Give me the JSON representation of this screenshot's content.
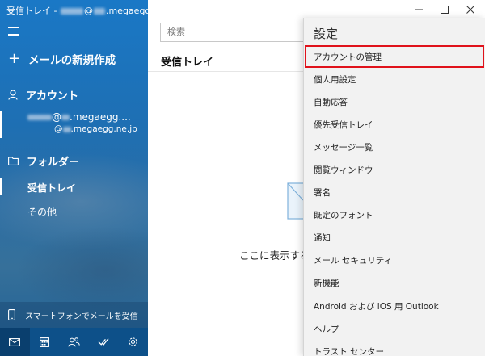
{
  "window": {
    "title_prefix": "受信トレイ - ",
    "title_suffix": "@",
    "title_domain": ".megaegg.ne.jp",
    "controls": {
      "minimize": "—",
      "maximize": "☐",
      "close": "✕"
    }
  },
  "sidebar": {
    "new_mail": "メールの新規作成",
    "accounts_header": "アカウント",
    "account_line1_at": "@",
    "account_line1_domain": ".megaegg....",
    "account_line2_at": "@",
    "account_line2_domain": ".megaegg.ne.jp",
    "folders_header": "フォルダー",
    "folders": [
      "受信トレイ",
      "その他"
    ],
    "phone_promo": "スマートフォンでメールを受信",
    "bottom_icons": [
      "mail-icon",
      "calendar-icon",
      "people-icon",
      "todo-icon",
      "settings-icon"
    ]
  },
  "main": {
    "search_placeholder": "検索",
    "inbox_title": "受信トレイ",
    "empty_text": "ここに表示するア"
  },
  "settings": {
    "title": "設定",
    "items": [
      "アカウントの管理",
      "個人用設定",
      "自動応答",
      "優先受信トレイ",
      "メッセージ一覧",
      "閲覧ウィンドウ",
      "署名",
      "既定のフォント",
      "通知",
      "メール セキュリティ",
      "新機能",
      "Android および iOS 用 Outlook",
      "ヘルプ",
      "トラスト センター"
    ],
    "highlight_color": "#e0121b"
  },
  "colors": {
    "sidebar_blue": "#1a78c6",
    "bottom_bar": "#0d5089",
    "flyout_bg": "#f2f2f2"
  }
}
